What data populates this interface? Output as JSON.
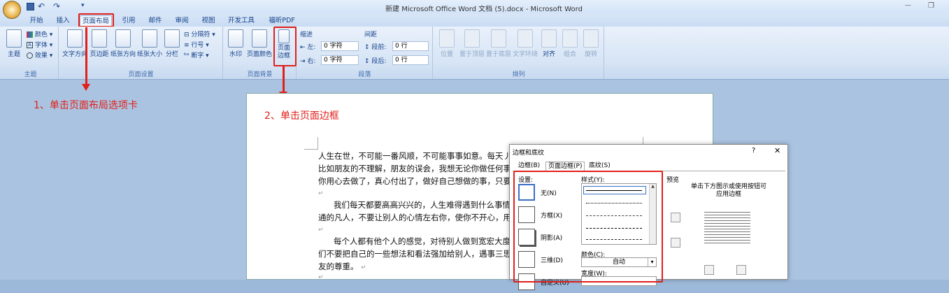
{
  "window": {
    "title": "新建 Microsoft Office Word 文档 (5).docx - Microsoft Word",
    "undo": "↶",
    "redo": "↷",
    "qat_more": "▾",
    "minimize": "—",
    "restore": "❐"
  },
  "tabs": [
    "开始",
    "插入",
    "页面布局",
    "引用",
    "邮件",
    "审阅",
    "视图",
    "开发工具",
    "福昕PDF"
  ],
  "ribbon": {
    "themes": {
      "label": "主题",
      "themes_btn": "主题",
      "colors": "颜色",
      "fonts": "字体",
      "effects": "效果"
    },
    "page_setup": {
      "label": "页面设置",
      "text_direction": "文字方向",
      "margins": "页边距",
      "orientation": "纸张方向",
      "size": "纸张大小",
      "columns": "分栏",
      "breaks": "分隔符",
      "line_numbers": "行号",
      "hyphenation": "断字"
    },
    "page_background": {
      "label": "页面背景",
      "watermark": "水印",
      "page_color": "页面颜色",
      "page_borders_l1": "页面",
      "page_borders_l2": "边框"
    },
    "paragraph": {
      "label": "段落",
      "indent": "缩进",
      "spacing": "间距",
      "left": "左:",
      "right": "右:",
      "left_val": "0 字符",
      "right_val": "0 字符",
      "before": "段前:",
      "after": "段后:",
      "before_val": "0 行",
      "after_val": "0 行"
    },
    "arrange": {
      "label": "排列",
      "position": "位置",
      "bring_front": "置于顶层",
      "send_back": "置于底层",
      "wrap": "文字环绕",
      "align": "对齐",
      "group": "组合",
      "rotate": "旋转"
    }
  },
  "annotations": {
    "step1": "1、单击页面布局选项卡",
    "step2": "2、单击页面边框"
  },
  "document": {
    "p1": [
      "人生在世，不可能一番风顺，不可能事事如意。每天丿",
      "比如朋友的不理解，朋友的误会，我想无论你做任何事",
      "你用心去做了，真心付出了，做好自己想做的事，只要"
    ],
    "p2": [
      "我们每天都要高高兴兴的，人生难得遇到什么事情",
      "通的凡人，不要让别人的心情左右你，使你不开心，用"
    ],
    "p3": [
      "每个人都有他个人的感觉，对待别人做到宽宏大度",
      "们不要把自己的一些想法和看法强加给别人，遇事三思",
      "友的尊重。"
    ],
    "return_mark": "↵"
  },
  "dialog": {
    "title": "边框和底纹",
    "help": "?",
    "close": "✕",
    "tabs": [
      "边框(B)",
      "页面边框(P)",
      "底纹(S)"
    ],
    "settings_label": "设置:",
    "settings": [
      "无(N)",
      "方框(X)",
      "阴影(A)",
      "三维(D)",
      "自定义(U)"
    ],
    "style_label": "样式(Y):",
    "color_label": "颜色(C):",
    "color_value": "自动",
    "width_label": "宽度(W):",
    "preview_label": "预览",
    "preview_hint_l1": "单击下方图示或使用按钮可",
    "preview_hint_l2": "应用边框"
  }
}
